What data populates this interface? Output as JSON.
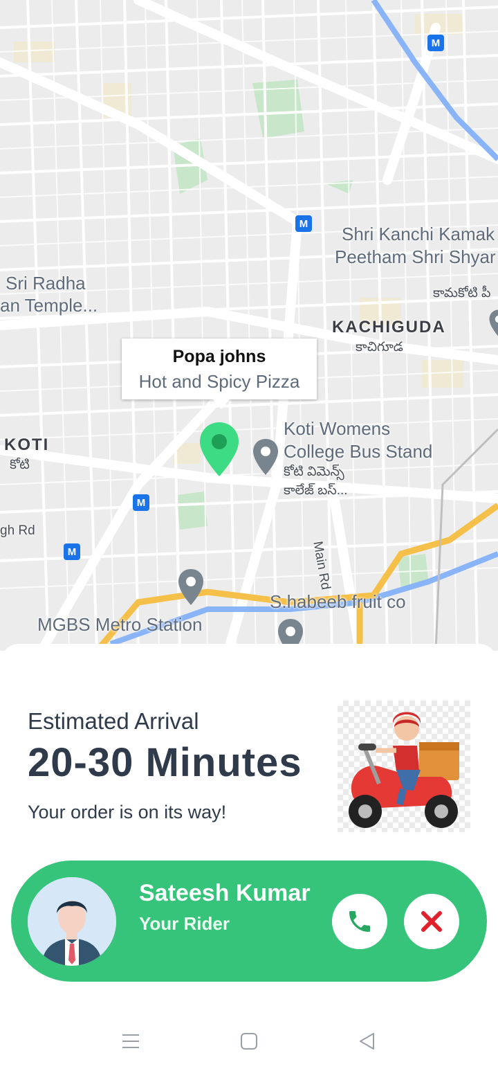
{
  "map": {
    "info_window": {
      "title": "Popa johns",
      "subtitle": "Hot and Spicy Pizza"
    },
    "labels": {
      "kanchi_1": "Shri Kanchi Kamak",
      "kanchi_2": "Peetham Shri Shyar",
      "radha_1": "Sri Radha",
      "radha_2": "an Temple...",
      "kachiguda": "KACHIGUDA",
      "kachiguda_te": "కాచిగూడ",
      "koti": "KOTI",
      "koti_te": "కోటి",
      "bus_1": "Koti Womens",
      "bus_2": "College Bus Stand",
      "bus_te_1": "కోటి విమెన్స్",
      "bus_te_2": "కాలేజ్ బస్...",
      "main_rd": "Main Rd",
      "gh_rd": "gh Rd",
      "habeeb": "S.habeeb fruit co",
      "mgbs": "MGBS Metro Station",
      "kamakoti_te": "కామకోటి పీ",
      "metro_letter": "M"
    },
    "colors": {
      "pin": "#3ddc84",
      "route": "#f5c04a",
      "river": "#8ab4f8",
      "park": "#c8e6c9"
    }
  },
  "delivery": {
    "eta_label": "Estimated Arrival",
    "eta_value": "20-30 Minutes",
    "status": "Your order is on its way!"
  },
  "rider": {
    "name": "Sateesh Kumar",
    "role": "Your Rider",
    "card_color": "#35c47a",
    "call_icon": "phone-icon",
    "cancel_icon": "close-icon"
  },
  "navbar": {
    "icons": [
      "menu-icon",
      "home-icon",
      "back-icon"
    ]
  }
}
